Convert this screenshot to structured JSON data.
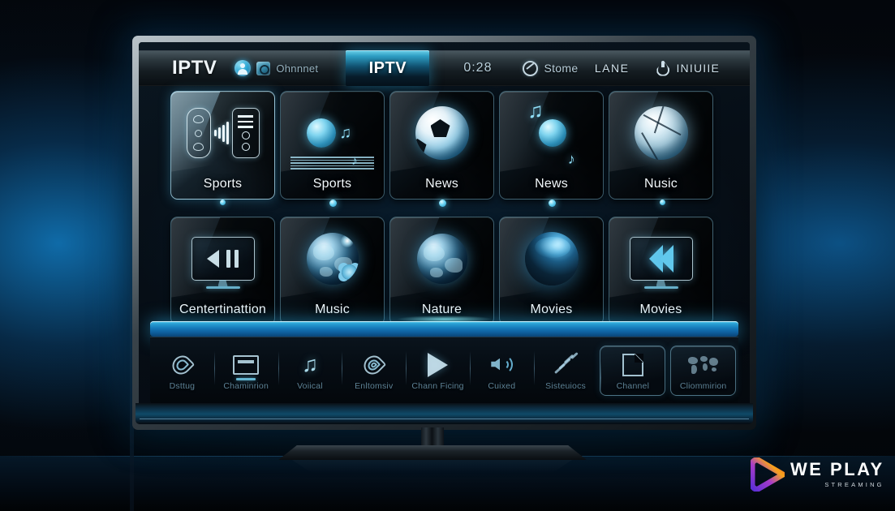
{
  "header": {
    "title": "IPTV",
    "user_icon": "user-avatar-icon",
    "channel_icon": "channel-square-icon",
    "channel_label": "Ohnnnet",
    "active_tab": "IPTV",
    "time": "0:28",
    "clock_icon": "clock-icon",
    "store_label": "Stome",
    "lane_label": "LANE",
    "droplet_icon": "droplet-icon",
    "inuie_label": "INIUIIE"
  },
  "grid": {
    "row1": [
      {
        "label": "Sports",
        "icon": "remote-control-signal-icon",
        "selected": true
      },
      {
        "label": "Sports",
        "icon": "music-orb-icon",
        "selected": false
      },
      {
        "label": "News",
        "icon": "soccer-ball-icon",
        "selected": false
      },
      {
        "label": "News",
        "icon": "music-disc-icon",
        "selected": false
      },
      {
        "label": "Nusic",
        "icon": "volleyball-icon",
        "selected": false
      }
    ],
    "row2": [
      {
        "label": "Centertinattion",
        "icon": "tv-playback-icon",
        "selected": false
      },
      {
        "label": "Music",
        "icon": "globe-flower-icon",
        "selected": false
      },
      {
        "label": "Nature",
        "icon": "earth-globe-icon",
        "selected": false
      },
      {
        "label": "Movies",
        "icon": "dark-earth-icon",
        "selected": false
      },
      {
        "label": "Movies",
        "icon": "tv-rewind-icon",
        "selected": false
      }
    ]
  },
  "pager": {
    "dots": 5,
    "active_index": 0
  },
  "dock": {
    "items": [
      {
        "label": "Dsttug",
        "icon": "heart-icon",
        "boxed": false
      },
      {
        "label": "Chaminrion",
        "icon": "monitor-icon",
        "boxed": false
      },
      {
        "label": "Voiical",
        "icon": "music-note-icon",
        "boxed": false
      },
      {
        "label": "Enltomsiv",
        "icon": "heart-rings-icon",
        "boxed": false
      },
      {
        "label": "Chann Ficing",
        "icon": "play-icon",
        "boxed": false
      },
      {
        "label": "Cuixed",
        "icon": "speaker-icon",
        "boxed": false
      },
      {
        "label": "Sisteuiocs",
        "icon": "swoosh-icon",
        "boxed": false
      },
      {
        "label": "Channel",
        "icon": "page-corner-icon",
        "boxed": true
      },
      {
        "label": "Cliommirion",
        "icon": "world-map-icon",
        "boxed": true
      }
    ]
  },
  "logo": {
    "mark": "play-triangle-logo",
    "name": "WE PLAY",
    "tagline": "STREAMING"
  },
  "colors": {
    "accent_cyan": "#2ba3d6",
    "accent_blue": "#1478b8",
    "tile_border": "#78b4cd",
    "dock_label": "#5d8296",
    "screen_bg": "#071019"
  }
}
